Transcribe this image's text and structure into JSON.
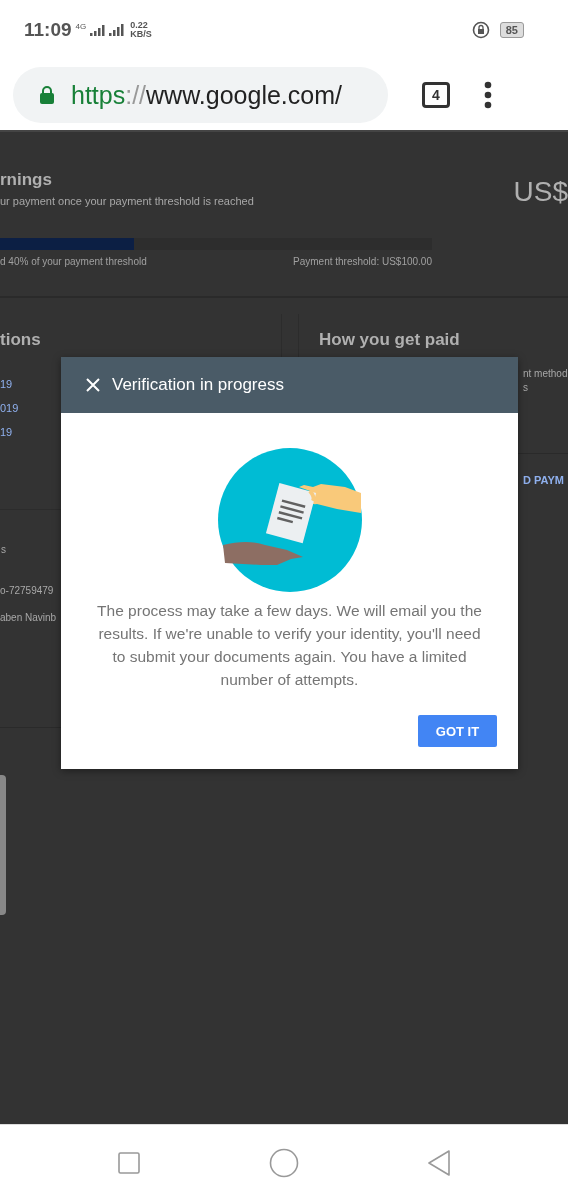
{
  "status_bar": {
    "time": "11:09",
    "network": "4G",
    "speed": "0.22",
    "speed_unit": "KB/S",
    "battery": "85"
  },
  "browser": {
    "url_scheme": "https",
    "url_sep": "://",
    "url_host": "www.google.com/",
    "tab_count": "4"
  },
  "earnings": {
    "title": "rnings",
    "subtitle": "ur payment once your payment threshold is reached",
    "amount": "US$",
    "progress": {
      "level": 0.31
    },
    "progress_label": "d 40% of your payment threshold",
    "threshold": "Payment threshold: US$100.00"
  },
  "transactions": {
    "title": "tions",
    "dates": [
      "19",
      "019",
      "19"
    ]
  },
  "payment": {
    "title": "How you get paid",
    "line_1": "nt method",
    "line_2": "s",
    "action": "D PAYM"
  },
  "settings": {
    "title": "s",
    "id": "o-72759479",
    "name": "aben Navinb"
  },
  "dialog": {
    "title": "Verification in progress",
    "body": "The process may take a few days. We will email you the results. If we're unable to verify your identity, you'll need to submit your documents again. You have a limited number of attempts.",
    "button": "GOT IT"
  }
}
